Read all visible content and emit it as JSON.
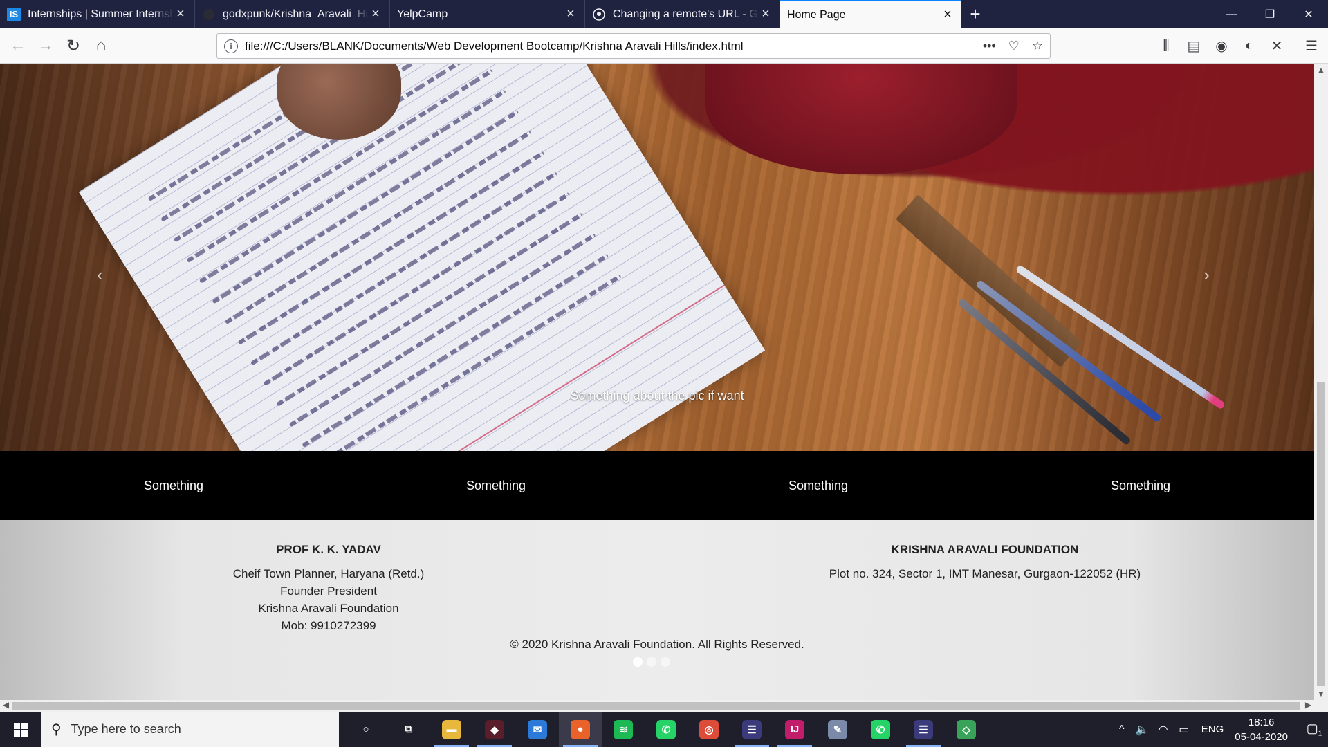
{
  "browser": {
    "tabs": [
      {
        "title": "Internships | Summer Internships",
        "icon": "internshala-icon",
        "icon_text": "IS",
        "active": false
      },
      {
        "title": "godxpunk/Krishna_Aravali_Hills",
        "icon": "github-icon",
        "icon_text": "",
        "active": false
      },
      {
        "title": "YelpCamp",
        "icon": "blank-page-icon",
        "icon_text": "",
        "active": false
      },
      {
        "title": "Changing a remote's URL - GitHub",
        "icon": "github-icon",
        "icon_text": "",
        "active": false
      },
      {
        "title": "Home Page",
        "icon": "",
        "icon_text": "",
        "active": true
      }
    ],
    "url": "file:///C:/Users/BLANK/Documents/Web Development Bootcamp/Krishna Aravali Hills/index.html"
  },
  "page": {
    "carousel": {
      "caption": "Something about the pic if want",
      "prev_glyph": "‹",
      "next_glyph": "›",
      "slide_count": 3,
      "active_slide": 1
    },
    "features": [
      "Something",
      "Something",
      "Something",
      "Something"
    ],
    "footer": {
      "left": {
        "heading": "PROF K. K. YADAV",
        "lines": [
          "Cheif Town Planner, Haryana (Retd.)",
          "Founder President",
          "Krishna Aravali Foundation",
          "Mob: 9910272399"
        ]
      },
      "right": {
        "heading": "KRISHNA ARAVALI FOUNDATION",
        "lines": [
          "Plot no. 324, Sector 1, IMT Manesar, Gurgaon-122052 (HR)"
        ]
      },
      "copyright": "© 2020 Krishna Aravali Foundation. All Rights Reserved."
    }
  },
  "taskbar": {
    "search_placeholder": "Type here to search",
    "apps": [
      {
        "name": "cortana-icon",
        "color": "#1f1f2b",
        "glyph": "○"
      },
      {
        "name": "task-view-icon",
        "color": "#1f1f2b",
        "glyph": "⧉"
      },
      {
        "name": "file-explorer-icon",
        "color": "#e8b83d",
        "glyph": "▬"
      },
      {
        "name": "game-app-icon",
        "color": "#5a1e2a",
        "glyph": "◆"
      },
      {
        "name": "mail-icon",
        "color": "#2b79d8",
        "glyph": "✉"
      },
      {
        "name": "firefox-icon",
        "color": "#e8622a",
        "glyph": "●"
      },
      {
        "name": "spotify-icon",
        "color": "#1db954",
        "glyph": "≋"
      },
      {
        "name": "whatsapp-icon",
        "color": "#25d366",
        "glyph": "✆"
      },
      {
        "name": "chrome-icon",
        "color": "#dd4b39",
        "glyph": "◎"
      },
      {
        "name": "eclipse-icon",
        "color": "#3b3a7a",
        "glyph": "☰"
      },
      {
        "name": "intellij-icon",
        "color": "#c11d6b",
        "glyph": "IJ"
      },
      {
        "name": "paint-app-icon",
        "color": "#7a8aa8",
        "glyph": "✎"
      },
      {
        "name": "whatsapp-icon-2",
        "color": "#25d366",
        "glyph": "✆"
      },
      {
        "name": "eclipse-icon-2",
        "color": "#3b3a7a",
        "glyph": "☰"
      },
      {
        "name": "git-icon",
        "color": "#3aa35a",
        "glyph": "◇"
      }
    ],
    "running_app_index": 5,
    "language": "ENG",
    "time": "18:16",
    "date": "05-04-2020",
    "notification_count": "1"
  }
}
